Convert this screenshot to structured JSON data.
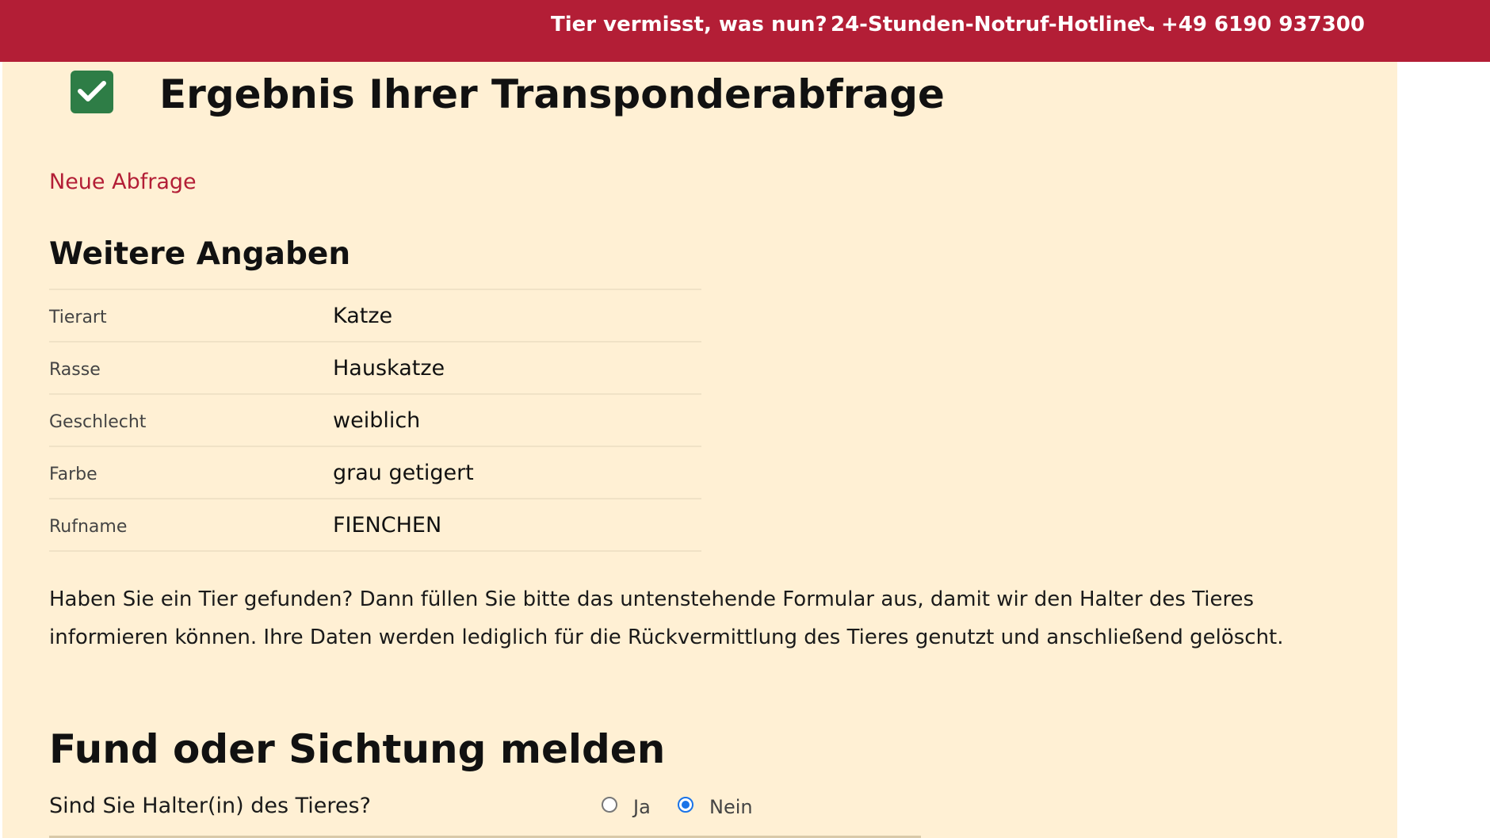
{
  "topbar": {
    "lost_link": "Tier vermisst, was nun?",
    "hotline_label": "24-Stunden-Notruf-Hotline",
    "phone_icon": "phone-icon",
    "phone_number": "+49 6190 937300",
    "background_color": "#b31e36"
  },
  "result": {
    "check_icon": "check-square-icon",
    "title": "Ergebnis Ihrer Transponderabfrage",
    "new_query_link": "Neue Abfrage"
  },
  "details": {
    "heading": "Weitere Angaben",
    "rows": [
      {
        "label": "Tierart",
        "value": "Katze"
      },
      {
        "label": "Rasse",
        "value": "Hauskatze"
      },
      {
        "label": "Geschlecht",
        "value": "weiblich"
      },
      {
        "label": "Farbe",
        "value": "grau getigert"
      },
      {
        "label": "Rufname",
        "value": "FIENCHEN"
      }
    ]
  },
  "info_text": "Haben Sie ein Tier gefunden? Dann füllen Sie bitte das untenstehende Formular aus, damit wir den Halter des Tieres informieren können. Ihre Daten werden lediglich für die Rückvermittlung des Tieres genutzt und anschließend gelöscht.",
  "report": {
    "heading": "Fund oder Sichtung melden",
    "owner_question": "Sind Sie Halter(in) des Tieres?",
    "options": [
      {
        "label": "Ja",
        "selected": false
      },
      {
        "label": "Nein",
        "selected": true
      }
    ]
  },
  "colors": {
    "accent": "#b31e36",
    "panel_background": "#fff0d4",
    "check_green": "#2e7d46",
    "radio_selected": "#1a73e8"
  }
}
